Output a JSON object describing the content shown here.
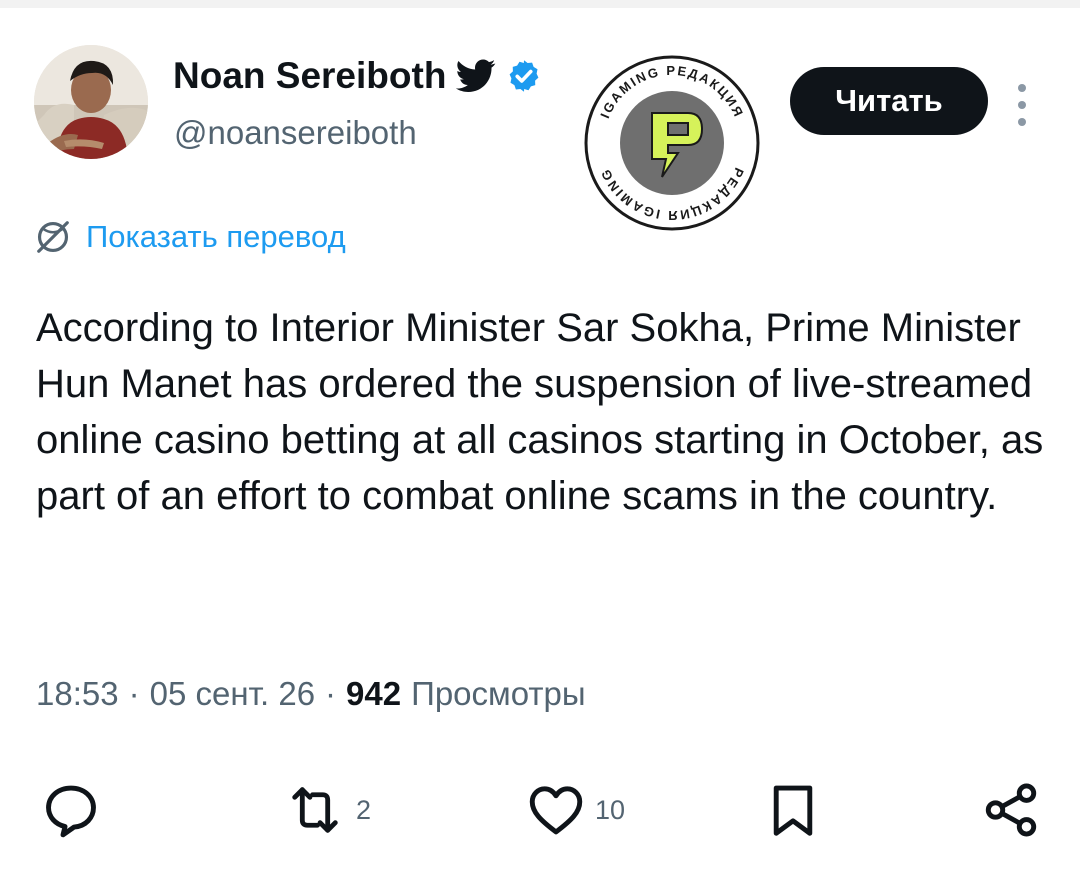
{
  "user": {
    "display_name": "Noan Sereiboth",
    "handle": "@noansereiboth"
  },
  "watermark": {
    "ring_text_top": "IGAMING РЕДАКЦИЯ",
    "ring_text_bottom": "РЕДАКЦИЯ IGAMING",
    "letter": "Р",
    "accent_color": "#d6f25a"
  },
  "follow_button": {
    "label": "Читать"
  },
  "translate": {
    "label": "Показать перевод"
  },
  "tweet": {
    "text": "According to Interior Minister Sar Sokha, Prime Minister Hun Manet has ordered the suspension of live-streamed online casino betting at all casinos starting in October, as part of an effort to combat online scams in the country."
  },
  "meta": {
    "time": "18:53",
    "date": "05 сент. 26",
    "views_count": "942",
    "views_label": "Просмотры"
  },
  "actions": {
    "reply_count": "",
    "retweet_count": "2",
    "like_count": "10"
  },
  "colors": {
    "link_blue": "#1d9bf0",
    "verified_blue": "#1d9bf0",
    "text_primary": "#0f1419",
    "text_secondary": "#536471"
  }
}
